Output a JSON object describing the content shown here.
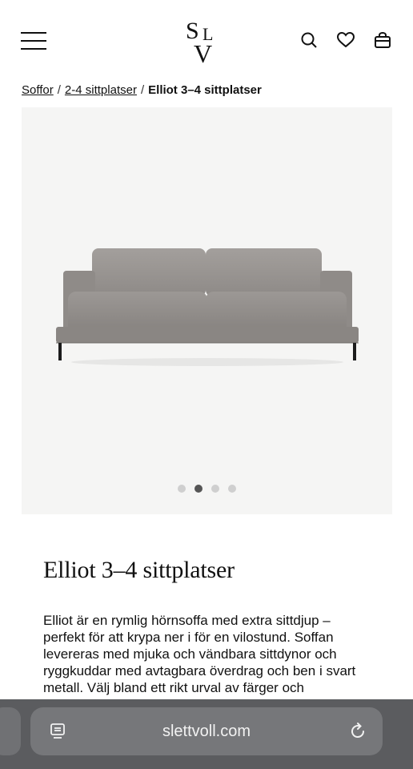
{
  "header": {
    "logo_text": "SLV",
    "icons": [
      "menu-icon",
      "search-icon",
      "heart-icon",
      "bag-icon"
    ]
  },
  "breadcrumb": {
    "items": [
      "Soffor",
      "2-4 sittplatser"
    ],
    "separator": "/",
    "current": "Elliot 3–4 sittplatser"
  },
  "gallery": {
    "total_images": 4,
    "active_index": 1
  },
  "product": {
    "title": "Elliot 3–4 sittplatser",
    "description": "Elliot är en rymlig hörnsoffa med extra sittdjup – perfekt för att krypa ner i för en vilostund. Soffan levereras med mjuka och vändbara sittdynor och ryggkuddar med avtagbara överdrag och ben i svart metall. Välj bland ett rikt urval av färger och"
  },
  "browser": {
    "url": "slettvoll.com"
  }
}
